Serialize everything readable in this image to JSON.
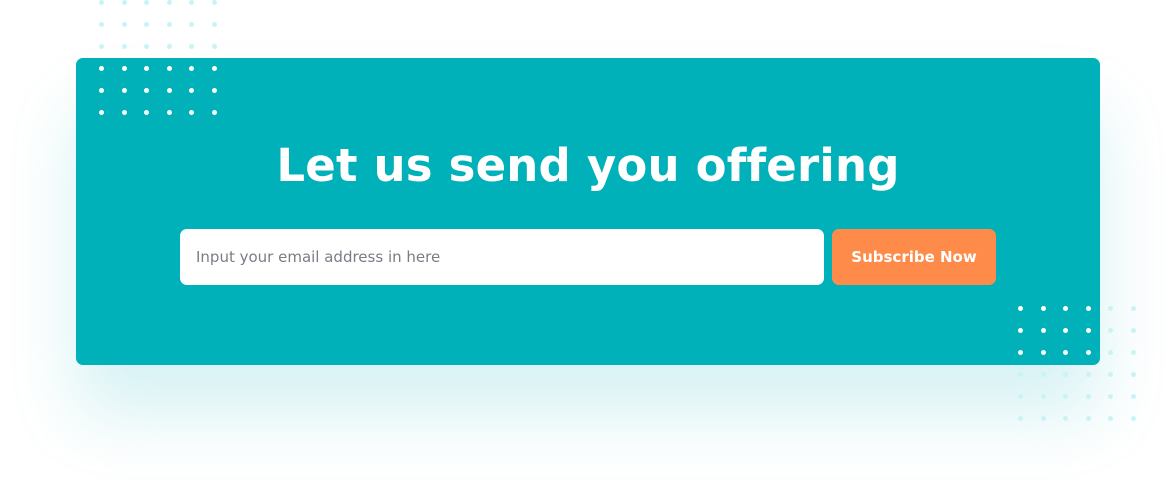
{
  "banner": {
    "headline": "Let us send you offering",
    "email_placeholder": "Input your email address in here",
    "email_value": "",
    "subscribe_label": "Subscribe Now"
  },
  "colors": {
    "banner_background": "#00B1B9",
    "button_background": "#FF8B4A",
    "button_text": "#FFFFFF",
    "headline_text": "#FFFFFF",
    "dot_on_banner": "#FFFFFF",
    "dot_off_banner": "#C9F4F6"
  },
  "decorations": {
    "dot_pattern_top_left": {
      "columns": 6,
      "rows": 6
    },
    "dot_pattern_bottom_right": {
      "columns": 6,
      "rows": 6
    }
  }
}
